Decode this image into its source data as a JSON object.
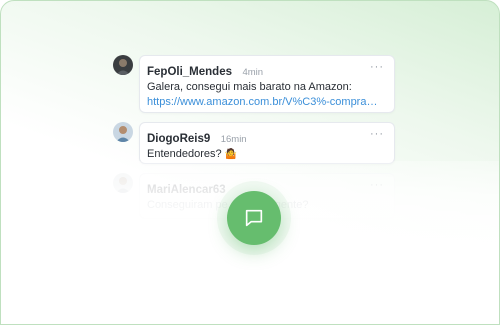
{
  "comments": [
    {
      "author": "FepOli_Mendes",
      "time": "4min",
      "text": "Galera, consegui mais barato na Amazon:",
      "link": "https://www.amazon.com.br/V%C3%-compra…",
      "more": "···"
    },
    {
      "author": "DiogoReis9",
      "time": "16min",
      "text": "Entendedores?",
      "emoji": "🤷",
      "more": "···"
    },
    {
      "author": "MariAlencar63",
      "time": "",
      "text": "Conseguiram pe… noção gente?",
      "more": "···"
    }
  ],
  "footer": {
    "title": "",
    "subtitle": ""
  },
  "fab": {
    "icon": "chat-bubble-icon",
    "color": "#66bd6e"
  }
}
